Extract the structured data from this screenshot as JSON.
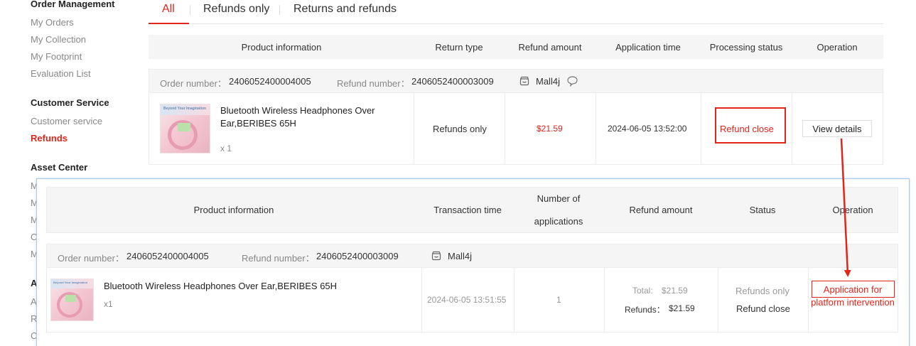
{
  "sidebar": {
    "order_management": {
      "title": "Order Management",
      "items": [
        "My Orders",
        "My Collection",
        "My Footprint",
        "Evaluation List"
      ]
    },
    "customer_service": {
      "title": "Customer Service",
      "items": [
        "Customer service",
        "Refunds"
      ]
    },
    "asset_center": {
      "title": "Asset Center",
      "partial_items": [
        "M",
        "M",
        "M",
        "C",
        "M"
      ]
    },
    "partial_section": {
      "title": "A",
      "partial_items": [
        "A",
        "R",
        "C"
      ]
    }
  },
  "tabs": [
    "All",
    "Refunds only",
    "Returns and refunds"
  ],
  "top_table": {
    "columns": [
      "Product information",
      "Return type",
      "Refund amount",
      "Application time",
      "Processing status",
      "Operation"
    ],
    "order": {
      "order_number_label": "Order number：",
      "order_number": "2406052400004005",
      "refund_number_label": "Refund number：",
      "refund_number": "2406052400003009",
      "shop": "Mall4j",
      "product_name": "Bluetooth Wireless Headphones Over Ear,BERIBES 65H",
      "quantity": "x 1",
      "return_type": "Refunds only",
      "refund_amount": "$21.59",
      "application_time": "2024-06-05 13:52:00",
      "processing_status": "Refund close",
      "operation": "View details"
    }
  },
  "panel": {
    "columns": {
      "product_information": "Product information",
      "transaction_time": "Transaction time",
      "number_of_applications_line1": "Number of",
      "number_of_applications_line2": "applications",
      "refund_amount": "Refund amount",
      "status": "Status",
      "operation": "Operation"
    },
    "order": {
      "order_number_label": "Order number：",
      "order_number": "2406052400004005",
      "refund_number_label": "Refund number：",
      "refund_number": "2406052400003009",
      "shop": "Mall4j",
      "product_name": "Bluetooth Wireless Headphones Over Ear,BERIBES 65H",
      "quantity": "x1",
      "transaction_time": "2024-06-05 13:51:55",
      "applications": "1",
      "total_label": "Total:",
      "total_value": "$21.59",
      "refunds_label": "Refunds：",
      "refunds_value": "$21.59",
      "status_line1": "Refunds only",
      "status_line2": "Refund close",
      "operation": "Application for platform intervention"
    }
  },
  "thumbnail_text": "Beyond Your Imagination",
  "colors": {
    "accent": "#e1251b",
    "annotation_arrow": "#e1251b",
    "panel_border": "#a9c9ec",
    "header_bg": "#f5f5f5"
  },
  "icons": [
    "shop-icon",
    "chat-icon",
    "shop-icon"
  ]
}
